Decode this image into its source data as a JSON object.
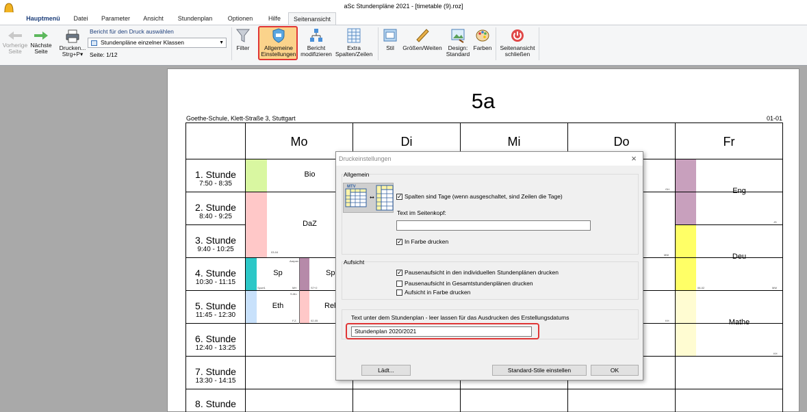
{
  "window": {
    "title": "aSc Stundenpläne 2021  - [timetable (9).roz]"
  },
  "menu": {
    "tabs": [
      "Hauptmenü",
      "Datei",
      "Parameter",
      "Ansicht",
      "Stundenplan",
      "Optionen",
      "Hilfe",
      "Seitenansicht"
    ],
    "active": "Seitenansicht"
  },
  "ribbon": {
    "prev_page": {
      "line1": "Vorherige",
      "line2": "Seite"
    },
    "next_page": {
      "line1": "Nächste",
      "line2": "Seite"
    },
    "print": {
      "line1": "Drucken...",
      "line2": "Strg+P"
    },
    "report_label": "Bericht für den Druck auswählen",
    "report_value": "Stundenpläne einzelner Klassen",
    "page_info": "Seite: 1/12",
    "filter": "Filter",
    "general_settings": {
      "line1": "Allgemeine",
      "line2": "Einstellungen"
    },
    "modify_report": {
      "line1": "Bericht",
      "line2": "modifizieren"
    },
    "extra_cols": {
      "line1": "Extra",
      "line2": "Spalten/Zeilen"
    },
    "style": "Stil",
    "sizes": "Größen/Weiten",
    "design": {
      "line1": "Design:",
      "line2": "Standard"
    },
    "colors": "Farben",
    "close_preview": {
      "line1": "Seitenansicht",
      "line2": "schließen"
    },
    "accent_colors": {
      "highlight": "#e03535",
      "active_button": "#fbd38b"
    }
  },
  "timetable": {
    "class_name": "5a",
    "school": "Goethe-Schule, Klett-Straße 3, Stuttgart",
    "page_code": "01-01",
    "days": [
      "Mo",
      "Di",
      "Mi",
      "Do",
      "Fr"
    ],
    "periods": [
      {
        "name": "1. Stunde",
        "time": "7:50 - 8:35"
      },
      {
        "name": "2. Stunde",
        "time": "8:40 - 9:25"
      },
      {
        "name": "3. Stunde",
        "time": "9:40 - 10:25"
      },
      {
        "name": "4. Stunde",
        "time": "10:30 - 11:15"
      },
      {
        "name": "5. Stunde",
        "time": "11:45 - 12:30"
      },
      {
        "name": "6. Stunde",
        "time": "12:40 - 13:25"
      },
      {
        "name": "7. Stunde",
        "time": "13:30 - 14:15"
      },
      {
        "name": "8. Stunde",
        "time": ""
      }
    ],
    "lessons": {
      "mo_bio": "Bio",
      "mo_daz": "DaZ",
      "mo_sp": "Sp",
      "mo_sp2": "Sp",
      "mo_eth": "Eth",
      "mo_rel": "Rel",
      "fr_eng": "Eng",
      "fr_deu": "Deu",
      "fr_mathe": "Mathe"
    },
    "tiny_labels": {
      "mo_daz_room": "03-04",
      "mo_sp_top": "Aarpan",
      "mo_sp_left": "Sport1",
      "mo_sp_mid": "MH",
      "mo_sp2_left": "S7+2",
      "mo_eth_top": "S-Mo",
      "mo_eth_mid": "F.Z.",
      "mo_rel_left": "02-05",
      "do_r1": "GH",
      "do_r3": "MW",
      "do_r5": "KH",
      "fr_eng_r": "JS",
      "fr_deu_l": "06-02",
      "fr_deu_r": "MW",
      "fr_mathe_r": "KH"
    },
    "lesson_colors": {
      "bio": "#d9f7a1",
      "daz": "#ffc8c8",
      "sp": "#2cc7c7",
      "sp2": "#b68aa9",
      "eth": "#c8e1fb",
      "rel": "#ffc8c8",
      "eng": "#c8a0bd",
      "deu": "#ffff66",
      "mathe": "#fffcd2"
    }
  },
  "dialog": {
    "title": "Druckeinstellungen",
    "close_glyph": "×",
    "general_group": "Allgemein",
    "columns_are_days": {
      "label": "Spalten sind Tage (wenn ausgeschaltet, sind Zeilen die Tage)",
      "checked": true
    },
    "header_text_label": "Text im Seitenkopf:",
    "header_text_value": "",
    "print_in_color": {
      "label": "In Farbe drucken",
      "checked": true
    },
    "supervision_group": "Aufsicht",
    "sup_individual": {
      "label": "Pausenaufsicht in den individuellen Stundenplänen drucken",
      "checked": true
    },
    "sup_overall": {
      "label": "Pausenaufsicht in Gesamtstundenplänen drucken",
      "checked": false
    },
    "sup_color": {
      "label": "Aufsicht in Farbe drucken",
      "checked": false
    },
    "note_label": "Text unter dem Stundenplan - leer lassen für das Ausdrucken des Erstellungsdatums",
    "note_value": "Stundenplan 2020/2021",
    "load_button": "Lädt...",
    "default_styles_button": "Standard-Stile einstellen",
    "ok_button": "OK",
    "preview_icon_letters": "MTV"
  }
}
